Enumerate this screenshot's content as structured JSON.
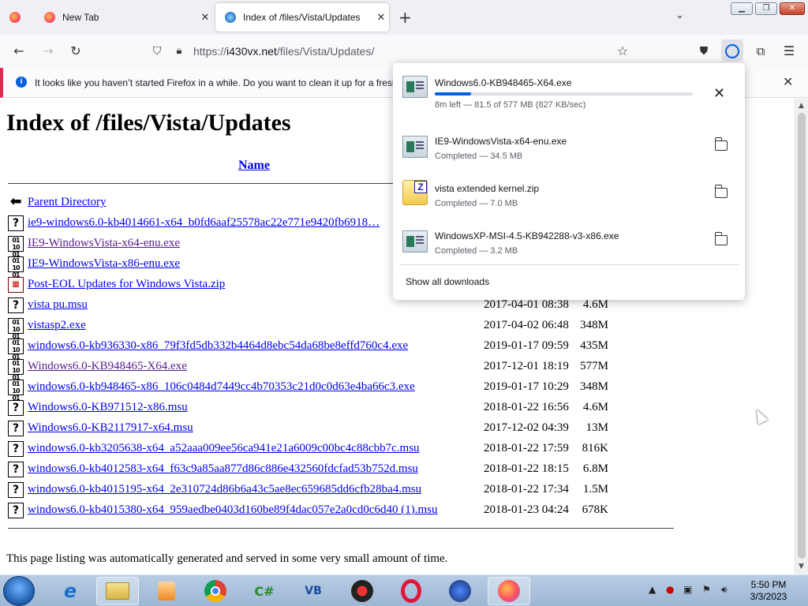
{
  "browser": {
    "tabs": [
      {
        "label": ""
      },
      {
        "label": "New Tab"
      },
      {
        "label": "Index of /files/Vista/Updates"
      }
    ],
    "new_tab_label": "+",
    "url": {
      "prefix": "https://",
      "host": "i430vx.net",
      "path": "/files/Vista/Updates/"
    },
    "notification": "It looks like you haven’t started Firefox in a while. Do you want to clean it up for a fresh"
  },
  "page": {
    "title": "Index of /files/Vista/Updates",
    "column_name": "Name",
    "parent": "Parent Directory",
    "files": [
      {
        "name": "ie9-windows6.0-kb4014661-x64_b0fd6aaf25578ac22e771e9420fb6918…",
        "date": "",
        "size": "",
        "icon": "?",
        "visited": false
      },
      {
        "name": "IE9-WindowsVista-x64-enu.exe",
        "date": "",
        "size": "",
        "icon": "bin",
        "visited": true
      },
      {
        "name": "IE9-WindowsVista-x86-enu.exe",
        "date": "",
        "size": "",
        "icon": "bin",
        "visited": false
      },
      {
        "name": "Post-EOL Updates for Windows Vista.zip",
        "date": "",
        "size": "",
        "icon": "zip",
        "visited": false
      },
      {
        "name": "vista pu.msu",
        "date": "2017-04-01 08:38",
        "size": "4.6M",
        "icon": "?",
        "visited": false
      },
      {
        "name": "vistasp2.exe",
        "date": "2017-04-02 06:48",
        "size": "348M",
        "icon": "bin",
        "visited": false
      },
      {
        "name": "windows6.0-kb936330-x86_79f3fd5db332b4464d8ebc54da68be8effd760c4.exe",
        "date": "2019-01-17 09:59",
        "size": "435M",
        "icon": "bin",
        "visited": false
      },
      {
        "name": "Windows6.0-KB948465-X64.exe",
        "date": "2017-12-01 18:19",
        "size": "577M",
        "icon": "bin",
        "visited": true
      },
      {
        "name": "windows6.0-kb948465-x86_106c0484d7449cc4b70353c21d0c0d63e4ba66c3.exe",
        "date": "2019-01-17 10:29",
        "size": "348M",
        "icon": "bin",
        "visited": false
      },
      {
        "name": "Windows6.0-KB971512-x86.msu",
        "date": "2018-01-22 16:56",
        "size": "4.6M",
        "icon": "?",
        "visited": false
      },
      {
        "name": "Windows6.0-KB2117917-x64.msu",
        "date": "2017-12-02 04:39",
        "size": "13M",
        "icon": "?",
        "visited": false
      },
      {
        "name": "windows6.0-kb3205638-x64_a52aaa009ee56ca941e21a6009c00bc4c88cbb7c.msu",
        "date": "2018-01-22 17:59",
        "size": "816K",
        "icon": "?",
        "visited": false
      },
      {
        "name": "windows6.0-kb4012583-x64_f63c9a85aa877d86c886e432560fdcfad53b752d.msu",
        "date": "2018-01-22 18:15",
        "size": "6.8M",
        "icon": "?",
        "visited": false
      },
      {
        "name": "windows6.0-kb4015195-x64_2e310724d86b6a43c5ae8ec659685dd6cfb28ba4.msu",
        "date": "2018-01-22 17:34",
        "size": "1.5M",
        "icon": "?",
        "visited": false
      },
      {
        "name": "windows6.0-kb4015380-x64_959aedbe0403d160be89f4dac057e2a0cd0c6d40 (1).msu",
        "date": "2018-01-23 04:24",
        "size": "678K",
        "icon": "?",
        "visited": false
      }
    ],
    "footer": "This page listing was automatically generated and served in some very small amount of time."
  },
  "downloads": {
    "items": [
      {
        "name": "Windows6.0-KB948465-X64.exe",
        "status": "8m left — 81.5 of 577 MB (827 KB/sec)",
        "progress": 0.141,
        "icon": "exe"
      },
      {
        "name": "IE9-WindowsVista-x64-enu.exe",
        "status": "Completed — 34.5 MB",
        "icon": "exe"
      },
      {
        "name": "vista extended kernel.zip",
        "status": "Completed — 7.0 MB",
        "icon": "zip"
      },
      {
        "name": "WindowsXP-MSI-4.5-KB942288-v3-x86.exe",
        "status": "Completed — 3.2 MB",
        "icon": "exe"
      }
    ],
    "show_all": "Show all downloads"
  },
  "taskbar": {
    "time": "5:50 PM",
    "date": "3/3/2023"
  },
  "colors": {
    "link": "#0000ee",
    "visited": "#551a8b",
    "accent": "#0061e0"
  }
}
